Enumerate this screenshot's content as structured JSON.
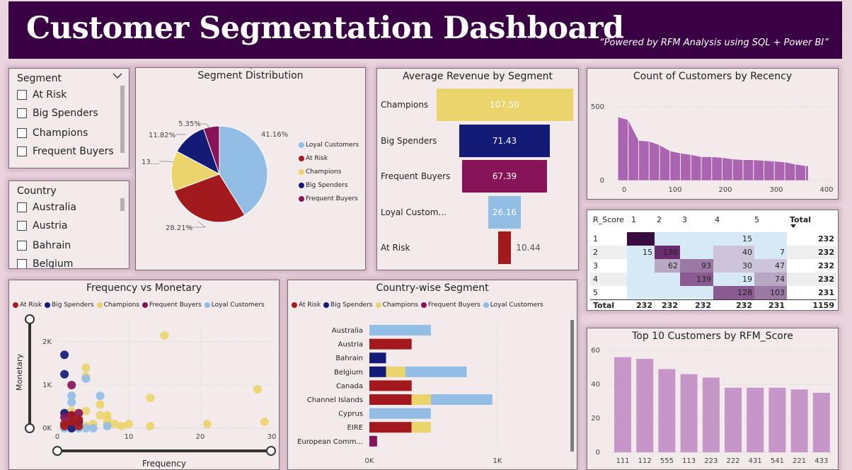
{
  "header": {
    "title": "Customer Segmentation Dashboard",
    "subtitle": "“Powered by RFM Analysis using SQL + Power BI”"
  },
  "segment_slicer": {
    "title": "Segment",
    "items": [
      "At Risk",
      "Big Spenders",
      "Champions",
      "Frequent Buyers"
    ]
  },
  "country_slicer": {
    "title": "Country",
    "items": [
      "Australia",
      "Austria",
      "Bahrain",
      "Belgium"
    ]
  },
  "colors": {
    "header": "#3a0044",
    "at_risk": "#a31a1e",
    "big_spenders": "#141b77",
    "champions": "#ecd46c",
    "frequent_buyers": "#871358",
    "loyal": "#92bee6",
    "histogram": "#9d4da6",
    "topbars": "#c796c9"
  },
  "pie": {
    "title": "Segment Distribution",
    "labels": {
      "loyal": "41.16%",
      "at_risk": "28.21%",
      "champions": "13....",
      "big_spenders": "11.82%",
      "frequent": "5.35%"
    },
    "legend": [
      "Loyal Customers",
      "At Risk",
      "Champions",
      "Big Spenders",
      "Frequent Buyers"
    ]
  },
  "funnel": {
    "title": "Average Revenue by Segment",
    "rows": [
      {
        "label": "Champions",
        "value": "107.50"
      },
      {
        "label": "Big Spenders",
        "value": "71.43"
      },
      {
        "label": "Frequent Buyers",
        "value": "67.39"
      },
      {
        "label": "Loyal Custom...",
        "value": "26.16"
      },
      {
        "label": "At Risk",
        "value": "10.44"
      }
    ]
  },
  "recency": {
    "title": "Count of Customers by Recency",
    "y_ticks": [
      "500",
      "0"
    ],
    "x_ticks": [
      "0",
      "100",
      "200",
      "300",
      "400"
    ]
  },
  "matrix": {
    "header": [
      "R_Score",
      "1",
      "2",
      "3",
      "4",
      "5",
      "Total"
    ],
    "rows": [
      [
        "1",
        "217",
        "",
        "",
        "15",
        "",
        "232"
      ],
      [
        "2",
        "15",
        "170",
        "",
        "40",
        "7",
        "232"
      ],
      [
        "3",
        "",
        "62",
        "93",
        "30",
        "47",
        "232"
      ],
      [
        "4",
        "",
        "",
        "139",
        "19",
        "74",
        "232"
      ],
      [
        "5",
        "",
        "",
        "",
        "128",
        "103",
        "231"
      ]
    ],
    "total": [
      "Total",
      "232",
      "232",
      "232",
      "232",
      "231",
      "1159"
    ]
  },
  "scatter": {
    "title": "Frequency vs Monetary",
    "xlabel": "Frequency",
    "ylabel": "Monetary",
    "y_ticks": [
      "2K",
      "1K",
      "0K"
    ],
    "x_ticks": [
      "0",
      "10",
      "20",
      "30"
    ],
    "legend": [
      "At Risk",
      "Big Spenders",
      "Champions",
      "Frequent Buyers",
      "Loyal Customers"
    ]
  },
  "country_chart": {
    "title": "Country-wise Segment",
    "legend": [
      "At Risk",
      "Big Spenders",
      "Champions",
      "Frequent Buyers",
      "Loyal Customers"
    ],
    "countries": [
      "Australia",
      "Austria",
      "Bahrain",
      "Belgium",
      "Canada",
      "Channel Islands",
      "Cyprus",
      "EIRE",
      "European Comm..."
    ],
    "x_ticks": [
      "0K",
      "1K"
    ]
  },
  "topcust": {
    "title": "Top 10 Customers by RFM_Score",
    "y_ticks": [
      "60",
      "40",
      "20",
      "0"
    ],
    "x_labels": [
      "111",
      "112",
      "555",
      "113",
      "223",
      "222",
      "431",
      "541",
      "221",
      "433"
    ]
  },
  "chart_data": [
    {
      "type": "pie",
      "title": "Segment Distribution",
      "categories": [
        "Loyal Customers",
        "At Risk",
        "Champions",
        "Big Spenders",
        "Frequent Buyers"
      ],
      "values": [
        41.16,
        28.21,
        13.46,
        11.82,
        5.35
      ]
    },
    {
      "type": "bar",
      "title": "Average Revenue by Segment",
      "categories": [
        "Champions",
        "Big Spenders",
        "Frequent Buyers",
        "Loyal Custom...",
        "At Risk"
      ],
      "values": [
        107.5,
        71.43,
        67.39,
        26.16,
        10.44
      ]
    },
    {
      "type": "area",
      "title": "Count of Customers by Recency",
      "x": [
        0,
        20,
        40,
        60,
        80,
        100,
        120,
        140,
        160,
        180,
        200,
        220,
        240,
        260,
        280,
        300,
        320,
        340,
        360
      ],
      "values": [
        430,
        410,
        270,
        265,
        240,
        200,
        185,
        175,
        160,
        160,
        155,
        145,
        140,
        140,
        135,
        130,
        125,
        110,
        100
      ],
      "xlim": [
        0,
        400
      ],
      "ylim": [
        0,
        550
      ]
    },
    {
      "type": "scatter",
      "title": "Frequency vs Monetary",
      "xlabel": "Frequency",
      "ylabel": "Monetary",
      "xlim": [
        0,
        30
      ],
      "ylim": [
        0,
        2500
      ],
      "series": [
        {
          "name": "At Risk",
          "points": [
            [
              1,
              50
            ],
            [
              1,
              100
            ],
            [
              2,
              150
            ],
            [
              2,
              300
            ],
            [
              3,
              200
            ],
            [
              3,
              50
            ]
          ]
        },
        {
          "name": "Big Spenders",
          "points": [
            [
              1,
              1700
            ],
            [
              1,
              1250
            ],
            [
              1,
              350
            ],
            [
              3,
              150
            ],
            [
              2,
              0
            ]
          ]
        },
        {
          "name": "Champions",
          "points": [
            [
              15,
              2150
            ],
            [
              28,
              900
            ],
            [
              29,
              150
            ],
            [
              21,
              100
            ],
            [
              13,
              700
            ],
            [
              13,
              50
            ],
            [
              6,
              550
            ],
            [
              7,
              200
            ],
            [
              7,
              100
            ],
            [
              5,
              100
            ],
            [
              4,
              1400
            ],
            [
              4,
              1200
            ],
            [
              4,
              400
            ],
            [
              8,
              100
            ],
            [
              6,
              300
            ],
            [
              7,
              300
            ],
            [
              9,
              50
            ],
            [
              10,
              100
            ],
            [
              1,
              300
            ],
            [
              2,
              400
            ],
            [
              4,
              50
            ],
            [
              2,
              50
            ]
          ]
        },
        {
          "name": "Frequent Buyers",
          "points": [
            [
              2,
              1000
            ],
            [
              2,
              300
            ],
            [
              3,
              350
            ],
            [
              1,
              250
            ],
            [
              2,
              150
            ]
          ]
        },
        {
          "name": "Loyal Customers",
          "points": [
            [
              1,
              100
            ],
            [
              1,
              50
            ],
            [
              2,
              100
            ],
            [
              2,
              600
            ],
            [
              2,
              750
            ],
            [
              4,
              1150
            ],
            [
              6,
              750
            ],
            [
              7,
              50
            ],
            [
              3,
              50
            ],
            [
              4,
              0
            ],
            [
              5,
              0
            ],
            [
              2,
              0
            ],
            [
              1,
              0
            ],
            [
              3,
              0
            ]
          ]
        }
      ]
    },
    {
      "type": "bar",
      "title": "Country-wise Segment",
      "orientation": "horizontal",
      "stacked": true,
      "categories": [
        "Australia",
        "Austria",
        "Bahrain",
        "Belgium",
        "Canada",
        "Channel Islands",
        "Cyprus",
        "EIRE",
        "European Comm..."
      ],
      "series": [
        {
          "name": "At Risk",
          "values": [
            0,
            330,
            0,
            0,
            330,
            330,
            0,
            330,
            0
          ]
        },
        {
          "name": "Big Spenders",
          "values": [
            0,
            0,
            130,
            130,
            0,
            0,
            0,
            0,
            0
          ]
        },
        {
          "name": "Champions",
          "values": [
            0,
            0,
            0,
            150,
            0,
            150,
            0,
            150,
            0
          ]
        },
        {
          "name": "Frequent Buyers",
          "values": [
            0,
            0,
            0,
            0,
            0,
            0,
            0,
            0,
            60
          ]
        },
        {
          "name": "Loyal Customers",
          "values": [
            480,
            0,
            0,
            480,
            0,
            480,
            480,
            0,
            0
          ]
        }
      ]
    },
    {
      "type": "bar",
      "title": "Top 10 Customers by RFM_Score",
      "categories": [
        "111",
        "112",
        "555",
        "113",
        "223",
        "222",
        "431",
        "541",
        "221",
        "433"
      ],
      "values": [
        56,
        55,
        49,
        46,
        44,
        38,
        38,
        38,
        37,
        35
      ],
      "ylim": [
        0,
        60
      ]
    }
  ]
}
